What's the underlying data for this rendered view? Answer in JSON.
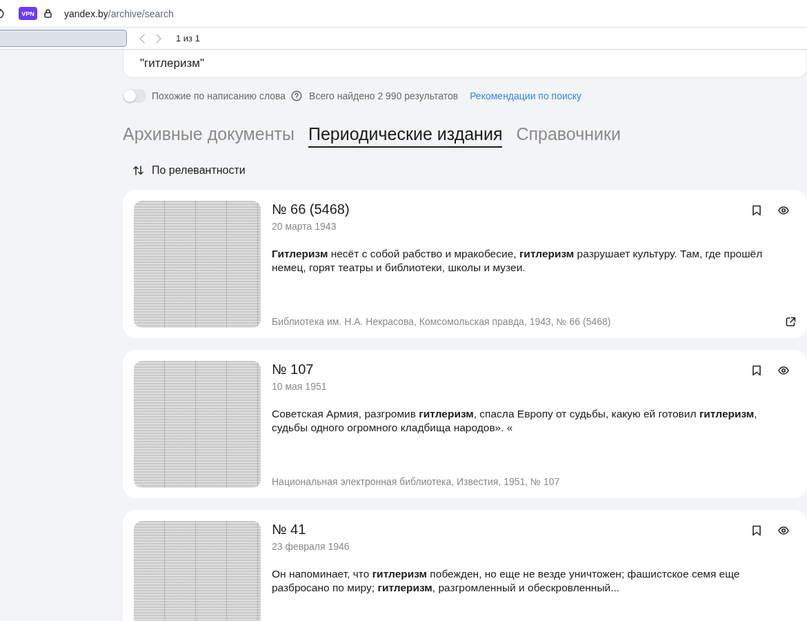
{
  "browser": {
    "vpn_badge": "VPN",
    "address": {
      "host": "yandex.by",
      "path": "/archive/search"
    }
  },
  "find_bar": {
    "buttons": [
      {
        "kind": "prev",
        "disabled": true
      },
      {
        "kind": "next",
        "disabled": true
      }
    ],
    "counter": "1 из 1"
  },
  "search": {
    "value": "\"гитлеризм\""
  },
  "filters": {
    "similar_spelling": {
      "label": "Похожие по написанию слова",
      "on": false
    },
    "total": "Всего найдено 2 990 результатов",
    "recommendations_link": "Рекомендации по поиску"
  },
  "tabs": [
    {
      "label": "Архивные документы",
      "selected": false
    },
    {
      "label": "Периодические издания",
      "selected": true
    },
    {
      "label": "Справочники",
      "selected": false
    }
  ],
  "sort": {
    "label": "По релевантности"
  },
  "results": [
    {
      "title": "№ 66 (5468)",
      "date": "20 марта 1943",
      "snippet": "**Гитлеризм** несёт с собой рабство и мракобесие, **гитлеризм** разрушает культуру. Там, где прошёл немец, горят театры и библиотеки, школы и музеи.",
      "source": "Библиотека им. Н.А. Некрасова, Комсомольская правда, 1943, № 66 (5468)",
      "external_link": true
    },
    {
      "title": "№ 107",
      "date": "10 мая 1951",
      "snippet": "Советская Армия, разгромив **гитлеризм**, спасла Европу от судьбы, какую ей готовил **гитлеризм**, судьбы одного огромного кладбища народов». «",
      "source": "Национальная электронная библиотека, Известия, 1951, № 107",
      "external_link": false
    },
    {
      "title": "№ 41",
      "date": "23 февраля 1946",
      "snippet": "Он напоминает, что **гитлеризм** побежден, но еще не везде уничтожен; фашистское семя еще разбросано по миру; **гитлеризм**, разгромленный и обескровленный..."
    }
  ]
}
